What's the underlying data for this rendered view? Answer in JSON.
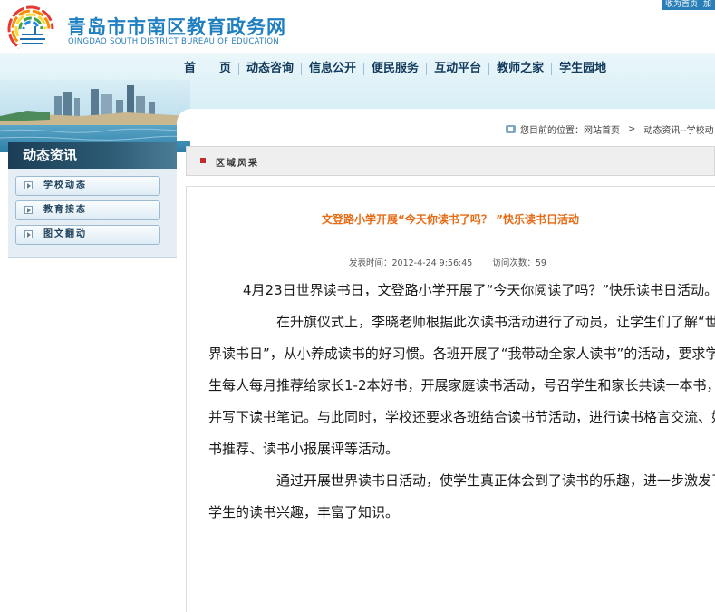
{
  "header": {
    "site_title": "青岛市市南区教育政务网",
    "site_subtitle": "QINGDAO SOUTH DISTRICT BUREAU OF EDUCATION",
    "top_links": [
      "收为首页",
      "加"
    ],
    "logo_icon": "rainbow-logo-icon"
  },
  "nav": {
    "items": [
      "首　　页",
      "动态咨询",
      "信息公开",
      "便民服务",
      "互动平台",
      "教师之家",
      "学生园地"
    ]
  },
  "sidebar": {
    "title": "动态资讯",
    "items": [
      "学校动态",
      "教育接态",
      "图文翻动"
    ]
  },
  "breadcrumb": {
    "label": "您目前的位置：网站首页",
    "separator": ">",
    "current": "动态资讯--学校动"
  },
  "section": {
    "label": "区域风采"
  },
  "article": {
    "title": "文登路小学开展“今天你读书了吗？ ”快乐读书日活动",
    "published_label": "发表时间：2012-4-24  9:56:45",
    "visits_label": "访问次数：59",
    "paragraphs": [
      "4月23日世界读书日，文登路小学开展了“今天你阅读了吗？”快乐读书日活动。",
      "在升旗仪式上，李晓老师根据此次读书活动进行了动员，让学生们了解“世界读书日”，从小养成读书的好习惯。各班开展了“我带动全家人读书”的活动，要求学生每人每月推荐给家长1-2本好书，开展家庭读书活动，号召学生和家长共读一本书，并写下读书笔记。与此同时，学校还要求各班结合读书节活动，进行读书格言交流、好书推荐、读书小报展评等活动。",
      "通过开展世界读书日活动，使学生真正体会到了读书的乐趣，进一步激发了学生的读书兴趣，丰富了知识。"
    ]
  },
  "colors": {
    "brand_blue": "#1f7fc0",
    "article_title": "#e66b14",
    "sidebar_header": "#1b3e56"
  }
}
